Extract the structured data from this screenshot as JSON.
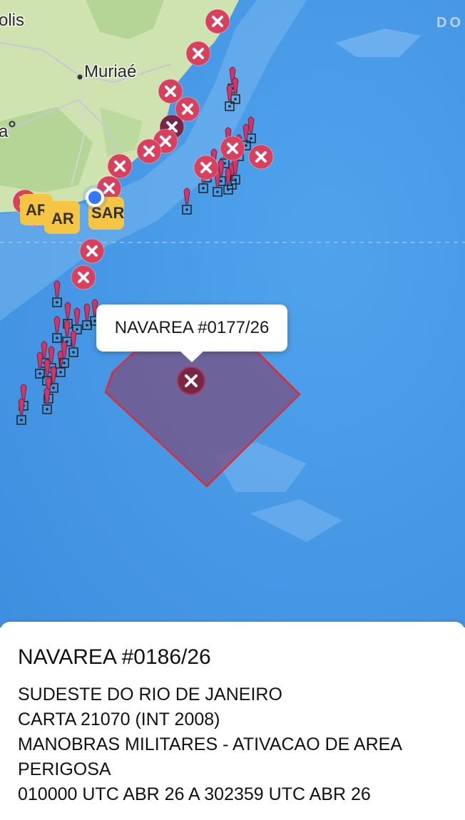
{
  "map": {
    "labels": {
      "city_muriae": "Muriaé",
      "partial_polis": "olis",
      "partial_a": "a",
      "corner_partial": "DO"
    },
    "sar_label": "SAR",
    "sar_partial_1": "AR",
    "sar_partial_2": "AR",
    "sar_partial_3": "SAR",
    "colors": {
      "ocean": "#4a9ae8",
      "land": "#cfe3b0",
      "danger_marker": "#d9405e",
      "danger_marker_dark": "#7a2446",
      "area_fill": "#7a4f80",
      "area_stroke": "#d62f3a",
      "location_dot": "#3478f6",
      "sar_badge": "#f6c544"
    }
  },
  "callout": {
    "title": "NAVAREA #0177/26"
  },
  "sheet": {
    "title": "NAVAREA #0186/26",
    "lines": [
      "SUDESTE DO RIO DE JANEIRO",
      "CARTA 21070 (INT 2008)",
      "MANOBRAS MILITARES - ATIVACAO DE AREA",
      "PERIGOSA",
      "010000 UTC ABR 26 A 302359 UTC ABR 26"
    ]
  }
}
